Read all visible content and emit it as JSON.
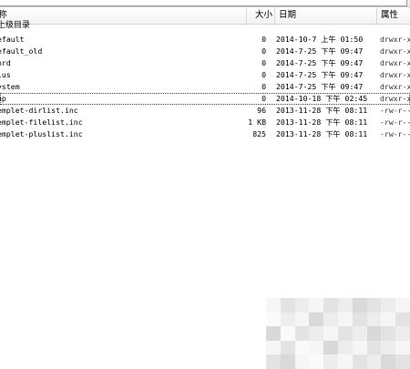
{
  "columns": {
    "name": "称",
    "size": "大小",
    "date": "日期",
    "attr": "属性"
  },
  "parent_dir": "上级目录",
  "rows": [
    {
      "name": "efault",
      "size": "0",
      "date": "2014-10-7 上午 01:50",
      "attr": "drwxr-xr-x"
    },
    {
      "name": "efault_old",
      "size": "0",
      "date": "2014-7-25 下午 09:47",
      "attr": "drwxr-xr-x"
    },
    {
      "name": "ord",
      "size": "0",
      "date": "2014-7-25 下午 09:47",
      "attr": "drwxr-xr-x"
    },
    {
      "name": "lus",
      "size": "0",
      "date": "2014-7-25 下午 09:47",
      "attr": "drwxr-xr-x"
    },
    {
      "name": "ystem",
      "size": "0",
      "date": "2014-7-25 下午 09:47",
      "attr": "drwxr-xr-x"
    },
    {
      "name": "ap",
      "size": "0",
      "date": "2014-10-18 下午 02:45",
      "attr": "drwxr-xr-x",
      "selected": true
    },
    {
      "name": "emplet-dirlist.inc",
      "size": "96",
      "date": "2013-11-28 下午 08:11",
      "attr": "-rw-r--r--"
    },
    {
      "name": "emplet-filelist.inc",
      "size": "1 KB",
      "date": "2013-11-28 下午 08:11",
      "attr": "-rw-r--r--"
    },
    {
      "name": "emplet-pluslist.inc",
      "size": "825",
      "date": "2013-11-28 下午 08:11",
      "attr": "-rw-r--r--"
    }
  ]
}
